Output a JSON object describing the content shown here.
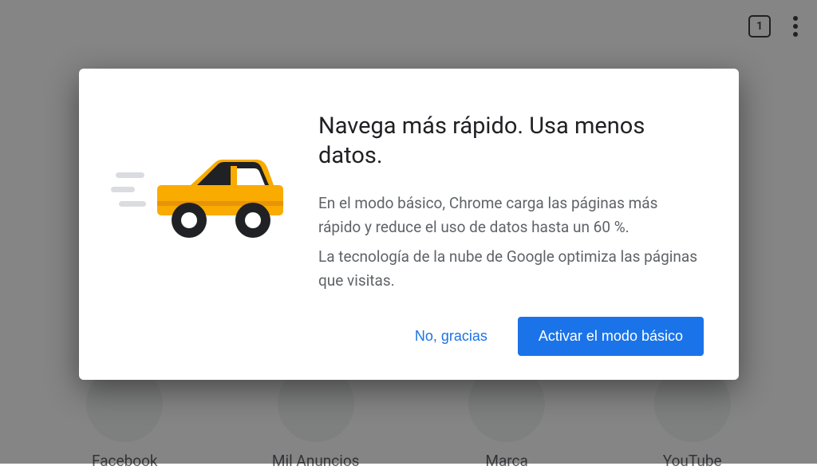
{
  "toolbar": {
    "tab_count": "1"
  },
  "shortcuts": {
    "row1": [
      {
        "label": "Facebook"
      },
      {
        "label": "Mil Anuncios"
      },
      {
        "label": "Marca"
      },
      {
        "label": "YouTube"
      }
    ]
  },
  "dialog": {
    "title": "Navega más rápido. Usa menos datos.",
    "body_line1": "En el modo básico, Chrome carga las páginas más rápido y reduce el uso de datos hasta un 60 %.",
    "body_line2": "La tecnología de la nube de Google optimiza las páginas que visitas.",
    "decline_label": "No, gracias",
    "accept_label": "Activar el modo básico"
  }
}
